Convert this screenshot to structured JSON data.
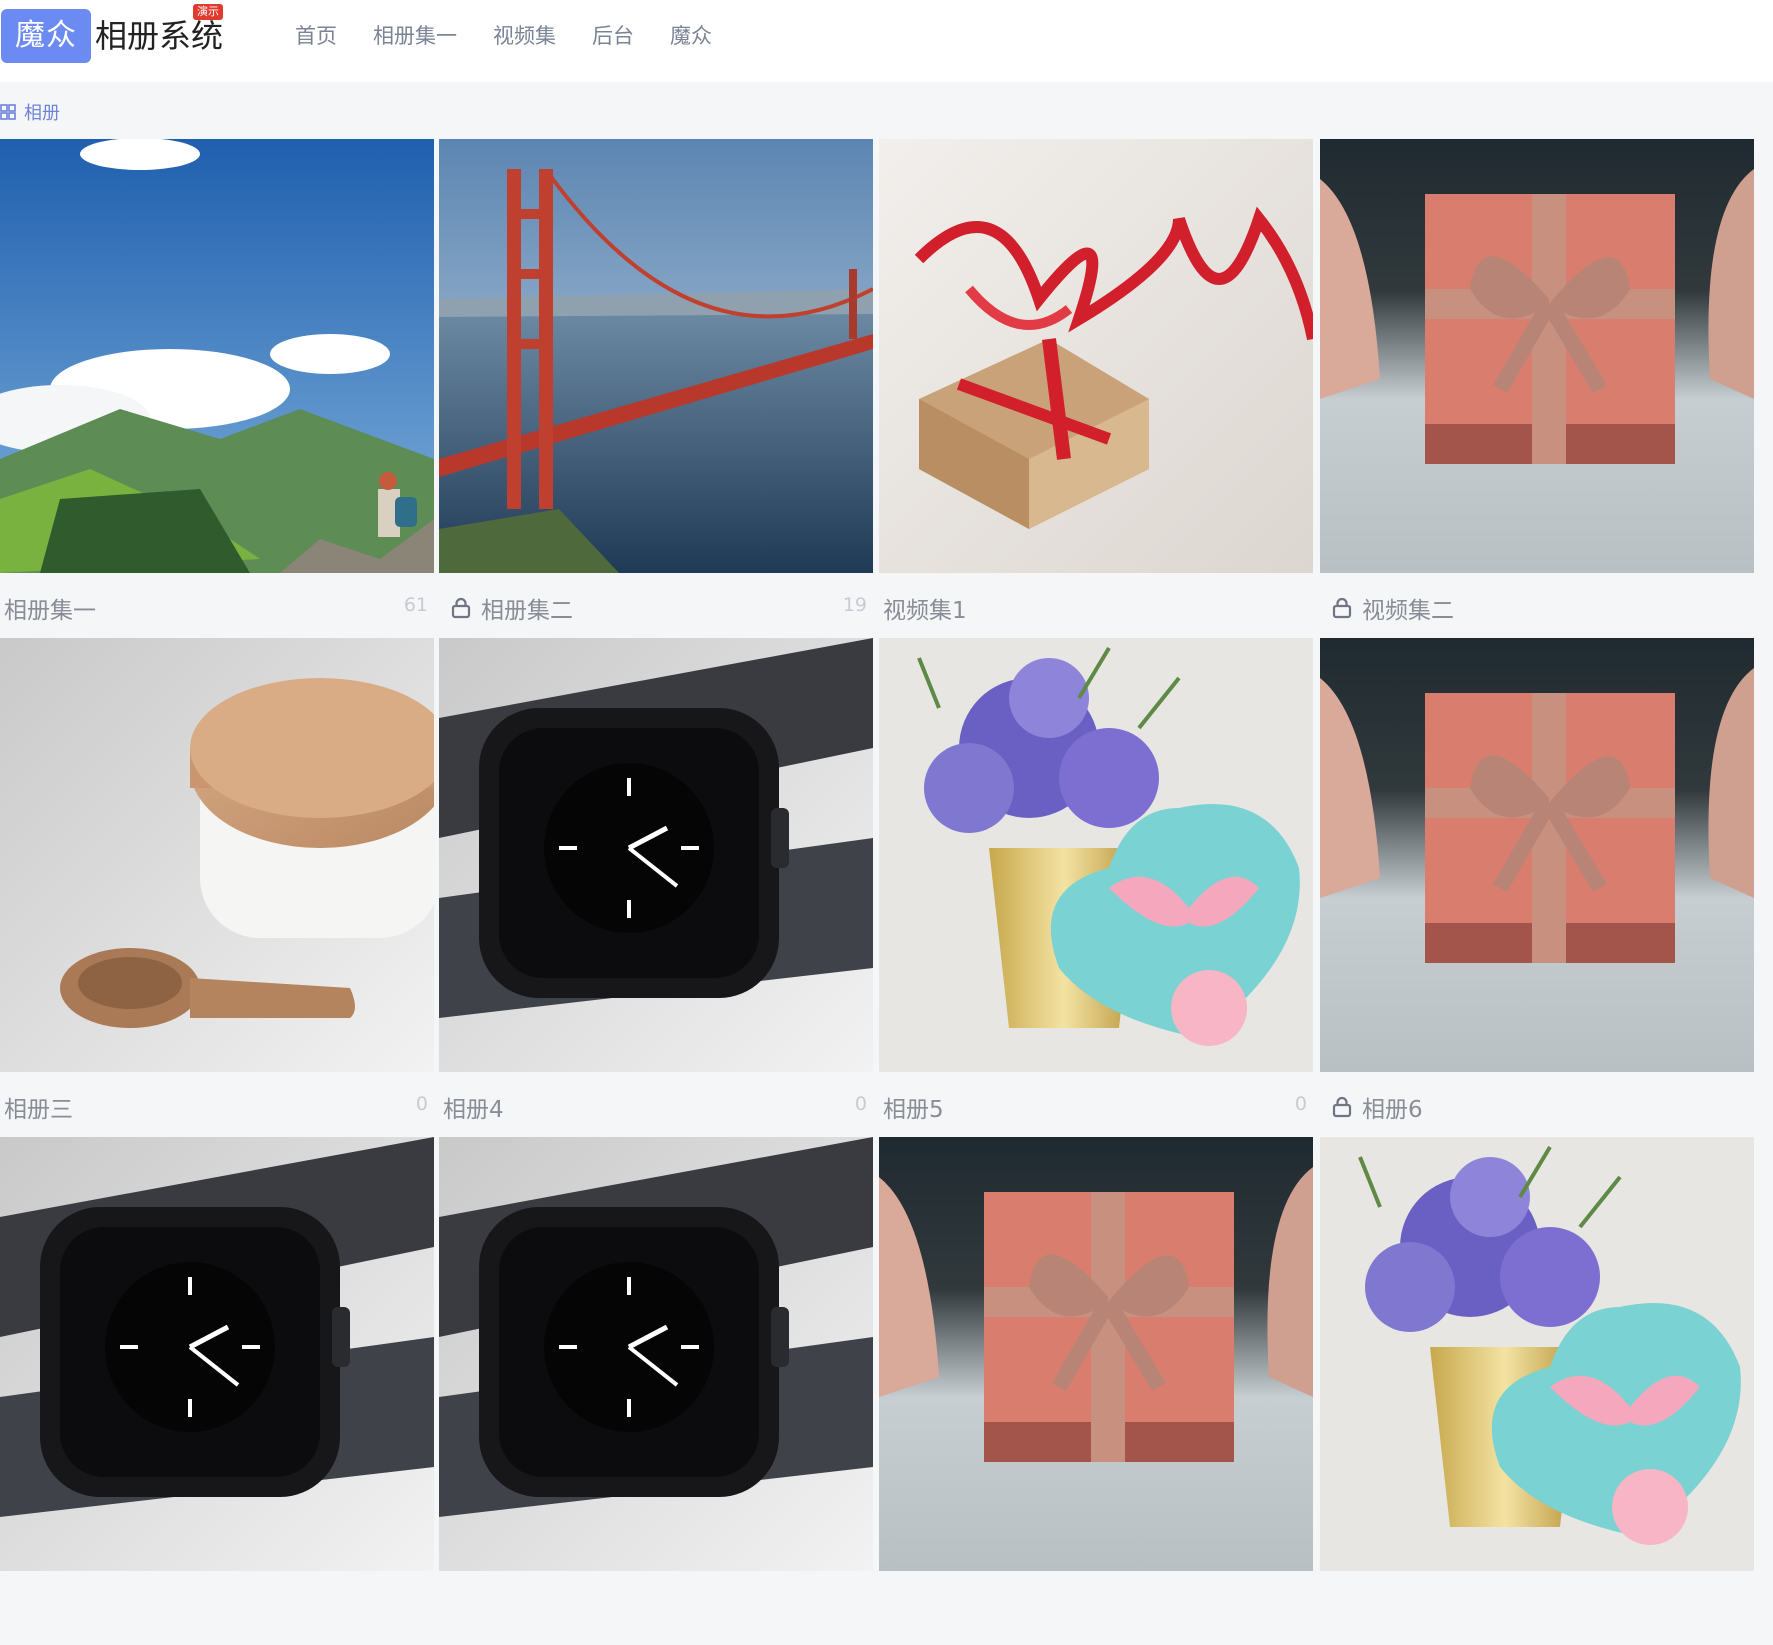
{
  "header": {
    "logo_text": "魔众",
    "title": "相册系统",
    "demo_badge": "演示",
    "nav": [
      "首页",
      "相册集一",
      "视频集",
      "后台",
      "魔众"
    ]
  },
  "breadcrumb": {
    "label": "相册"
  },
  "albums": [
    {
      "title": "相册集一",
      "count": "61",
      "locked": false,
      "image": "mountain-hiker"
    },
    {
      "title": "相册集二",
      "count": "19",
      "locked": true,
      "image": "golden-gate-bridge"
    },
    {
      "title": "视频集1",
      "count": "",
      "locked": false,
      "image": "gift-red-ribbon"
    },
    {
      "title": "视频集二",
      "count": "",
      "locked": true,
      "image": "pink-gift-box"
    },
    {
      "title": "相册三",
      "count": "0",
      "locked": false,
      "image": "jar-and-spoon"
    },
    {
      "title": "相册4",
      "count": "0",
      "locked": false,
      "image": "smart-watch"
    },
    {
      "title": "相册5",
      "count": "0",
      "locked": false,
      "image": "flowers-heart-box"
    },
    {
      "title": "相册6",
      "count": "",
      "locked": true,
      "image": "pink-gift-box"
    },
    {
      "title": "",
      "count": "",
      "locked": false,
      "image": "smart-watch"
    },
    {
      "title": "",
      "count": "",
      "locked": false,
      "image": "smart-watch"
    },
    {
      "title": "",
      "count": "",
      "locked": false,
      "image": "pink-gift-box"
    },
    {
      "title": "",
      "count": "",
      "locked": false,
      "image": "flowers-heart-box"
    }
  ],
  "colors": {
    "accent": "#6b8bf2",
    "demo_badge": "#e23a2f",
    "nav_text": "#7a8495",
    "breadcrumb": "#6f84d8",
    "page_bg": "#f5f6f8"
  }
}
